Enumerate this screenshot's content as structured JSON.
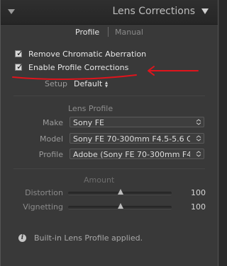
{
  "panel": {
    "title": "Lens Corrections"
  },
  "tabs": [
    {
      "label": "Profile",
      "active": true
    },
    {
      "label": "Manual",
      "active": false
    }
  ],
  "checks": {
    "remove_ca": {
      "label": "Remove Chromatic Aberration",
      "checked": true
    },
    "enable_profile": {
      "label": "Enable Profile Corrections",
      "checked": true
    }
  },
  "setup": {
    "label": "Setup",
    "value": "Default"
  },
  "lens_profile": {
    "title": "Lens Profile",
    "make_label": "Make",
    "make_value": "Sony FE",
    "model_label": "Model",
    "model_value": "Sony FE 70-300mm F4.5-5.6 G",
    "profile_label": "Profile",
    "profile_value": "Adobe (Sony FE 70-300mm F4..."
  },
  "amount": {
    "title": "Amount",
    "distortion_label": "Distortion",
    "distortion_value": "100",
    "vignetting_label": "Vignetting",
    "vignetting_value": "100"
  },
  "info": {
    "text": "Built-in Lens Profile applied."
  },
  "colors": {
    "annotation": "#e0141c",
    "panel_bg": "#393939"
  }
}
